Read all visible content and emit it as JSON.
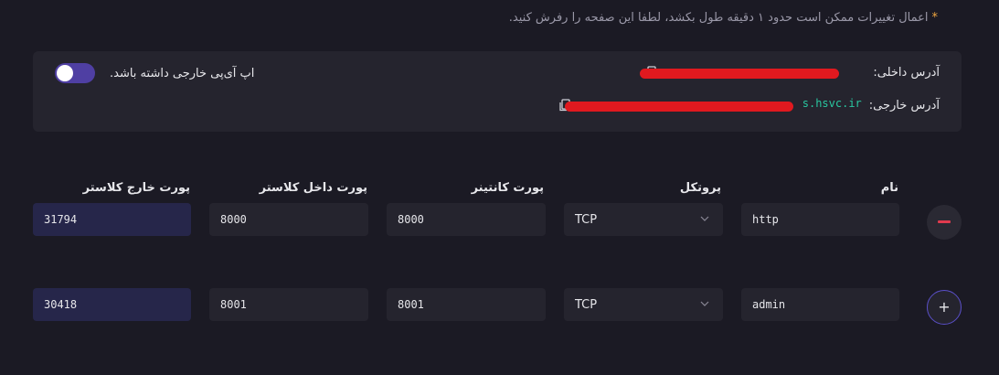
{
  "notice": {
    "star": "*",
    "text": "اعمال تغییرات ممکن است حدود ۱ دقیقه طول بکشد، لطفا این صفحه را رفرش کنید."
  },
  "info": {
    "internal_label": "آدرس داخلی:",
    "internal_value": "",
    "external_label": "آدرس خارجی:",
    "external_value": "s.hsvc.ir",
    "toggle_label": "اپ آی‌پی خارجی داشته باشد.",
    "toggle_on": true,
    "copy_icon": "copy-icon"
  },
  "columns": {
    "name": "نام",
    "protocol": "پروتکل",
    "container_port": "پورت کانتینر",
    "cluster_port": "پورت داخل کلاستر",
    "external_port": "پورت خارج کلاستر"
  },
  "rows": [
    {
      "name": "http",
      "protocol": "TCP",
      "container_port": "8000",
      "cluster_port": "8000",
      "external_port": "31794",
      "action": "−"
    },
    {
      "name": "admin",
      "protocol": "TCP",
      "container_port": "8001",
      "cluster_port": "8001",
      "external_port": "30418",
      "action": "+"
    }
  ],
  "colors": {
    "accent": "#5a4fc8",
    "toggle_on": "#4f3fa3",
    "remove": "#e03a4e",
    "address": "#29c7a0"
  }
}
